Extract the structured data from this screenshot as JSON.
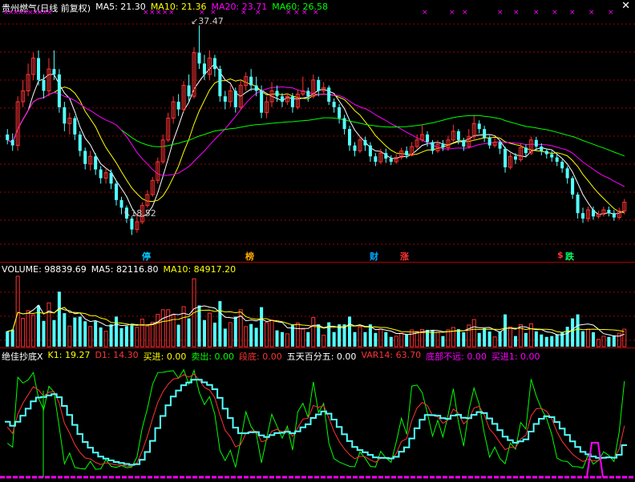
{
  "colors": {
    "ma5": "#ffffff",
    "ma10": "#ffff00",
    "ma20": "#ff00ff",
    "ma60": "#00ff00",
    "up": "#ff3333",
    "down": "#54ffff",
    "grid": "#a00000",
    "k_line": "#ffff00",
    "d_line": "#ff3333"
  },
  "price_header": {
    "title": "贵州燃气(日线 前复权)",
    "ma5": "MA5: 21.30",
    "ma10": "MA10: 21.36",
    "ma20": "MA20: 23.71",
    "ma60": "MA60: 26.58"
  },
  "price_annotations": {
    "high": "37.47",
    "low": "18.52"
  },
  "event_markers": [
    "停",
    "榜",
    "财",
    "涨",
    "$",
    "跌"
  ],
  "volume_header": {
    "volume": "VOLUME: 98839.69",
    "ma5": "MA5: 82116.80",
    "ma10": "MA10: 84917.20"
  },
  "indicator_header": {
    "name": "绝佳抄底X",
    "k1": "K1: 19.27",
    "d1": "D1: 14.30",
    "buy_in": "买进: 0.00",
    "sell_out": "卖出: 0.00",
    "bottom_zone": "段底: 0.00",
    "five_day": "五天百分五: 0.00",
    "var14": "VAR14: 63.70",
    "bottom_near": "底部不远: 0.00",
    "buy_in1": "买进1: 0.00"
  },
  "chart_data": {
    "type": "candlestick",
    "price_range": [
      16.5,
      38.5
    ],
    "candles": [
      [
        27.5,
        27.0,
        28.0,
        26.6
      ],
      [
        27.0,
        26.5,
        27.6,
        26.0
      ],
      [
        26.5,
        30.5,
        31.0,
        26.0
      ],
      [
        30.5,
        31.5,
        32.5,
        30.0
      ],
      [
        31.5,
        33.0,
        34.0,
        31.0
      ],
      [
        33.0,
        34.5,
        35.0,
        32.5
      ],
      [
        34.5,
        32.5,
        35.2,
        32.0
      ],
      [
        32.5,
        31.5,
        33.0,
        30.8
      ],
      [
        31.5,
        33.5,
        34.5,
        31.0
      ],
      [
        33.5,
        33.0,
        35.2,
        32.5
      ],
      [
        33.0,
        30.0,
        33.5,
        29.5
      ],
      [
        30.0,
        28.5,
        30.5,
        27.8
      ],
      [
        28.5,
        29.0,
        29.5,
        27.5
      ],
      [
        29.0,
        27.5,
        29.2,
        27.0
      ],
      [
        27.5,
        26.0,
        27.8,
        25.5
      ],
      [
        26.0,
        24.8,
        26.3,
        24.3
      ],
      [
        24.8,
        25.5,
        26.0,
        24.2
      ],
      [
        25.5,
        24.3,
        25.8,
        23.8
      ],
      [
        24.3,
        23.5,
        24.6,
        23.0
      ],
      [
        23.5,
        24.0,
        24.4,
        23.0
      ],
      [
        24.0,
        23.0,
        24.3,
        22.5
      ],
      [
        23.0,
        21.5,
        23.3,
        21.0
      ],
      [
        21.5,
        20.8,
        21.8,
        20.2
      ],
      [
        20.8,
        19.8,
        21.0,
        19.4
      ],
      [
        19.8,
        18.8,
        20.0,
        18.3
      ],
      [
        18.8,
        19.5,
        20.2,
        18.5
      ],
      [
        19.5,
        21.0,
        21.3,
        19.3
      ],
      [
        21.0,
        22.0,
        22.4,
        20.8
      ],
      [
        22.0,
        23.3,
        23.6,
        21.8
      ],
      [
        23.3,
        25.0,
        25.4,
        23.0
      ],
      [
        25.0,
        27.0,
        27.5,
        24.8
      ],
      [
        27.0,
        29.0,
        29.5,
        26.8
      ],
      [
        29.0,
        30.5,
        31.0,
        28.5
      ],
      [
        30.5,
        29.8,
        31.2,
        29.2
      ],
      [
        29.8,
        32.0,
        32.4,
        29.5
      ],
      [
        32.0,
        31.0,
        33.0,
        30.5
      ],
      [
        31.0,
        35.0,
        35.5,
        30.8
      ],
      [
        35.0,
        34.0,
        37.5,
        33.5
      ],
      [
        34.0,
        33.0,
        34.8,
        32.5
      ],
      [
        33.0,
        34.5,
        35.2,
        32.5
      ],
      [
        34.5,
        33.5,
        34.8,
        32.8
      ],
      [
        33.5,
        31.0,
        33.8,
        30.5
      ],
      [
        31.0,
        30.5,
        31.5,
        29.8
      ],
      [
        30.5,
        31.5,
        32.0,
        30.0
      ],
      [
        31.5,
        30.0,
        31.8,
        29.5
      ],
      [
        30.0,
        32.0,
        32.5,
        29.8
      ],
      [
        32.0,
        32.8,
        33.2,
        31.5
      ],
      [
        32.8,
        32.0,
        33.5,
        31.5
      ],
      [
        32.0,
        31.5,
        32.8,
        31.0
      ],
      [
        31.5,
        29.5,
        32.0,
        29.0
      ],
      [
        29.5,
        30.5,
        31.0,
        29.0
      ],
      [
        30.5,
        31.5,
        32.3,
        30.0
      ],
      [
        31.5,
        31.0,
        32.0,
        30.5
      ],
      [
        31.0,
        30.5,
        31.3,
        30.0
      ],
      [
        30.5,
        31.0,
        31.3,
        30.2
      ],
      [
        31.0,
        30.0,
        31.3,
        29.5
      ],
      [
        30.0,
        31.2,
        31.6,
        29.8
      ],
      [
        31.2,
        31.5,
        32.8,
        31.0
      ],
      [
        31.5,
        31.0,
        31.8,
        30.5
      ],
      [
        31.0,
        32.5,
        33.0,
        30.8
      ],
      [
        32.5,
        31.5,
        32.8,
        31.0
      ],
      [
        31.5,
        31.8,
        32.3,
        31.2
      ],
      [
        31.8,
        30.5,
        32.0,
        30.2
      ],
      [
        30.5,
        30.0,
        30.8,
        29.5
      ],
      [
        30.0,
        29.0,
        30.3,
        28.5
      ],
      [
        29.0,
        28.0,
        29.3,
        27.5
      ],
      [
        28.0,
        26.5,
        28.3,
        26.0
      ],
      [
        26.5,
        26.0,
        26.8,
        25.5
      ],
      [
        26.0,
        27.0,
        27.3,
        25.8
      ],
      [
        27.0,
        26.5,
        27.3,
        26.0
      ],
      [
        26.5,
        25.5,
        26.8,
        25.0
      ],
      [
        25.5,
        25.0,
        25.8,
        24.6
      ],
      [
        25.0,
        25.8,
        26.2,
        24.8
      ],
      [
        25.8,
        25.3,
        26.2,
        24.9
      ],
      [
        25.3,
        25.0,
        25.6,
        24.7
      ],
      [
        25.0,
        25.4,
        25.7,
        24.8
      ],
      [
        25.4,
        26.0,
        26.3,
        25.2
      ],
      [
        26.0,
        25.6,
        26.4,
        25.3
      ],
      [
        25.6,
        26.4,
        26.8,
        25.5
      ],
      [
        26.4,
        27.0,
        27.5,
        26.2
      ],
      [
        27.0,
        27.5,
        28.4,
        26.8
      ],
      [
        27.5,
        26.8,
        27.8,
        26.4
      ],
      [
        26.8,
        26.0,
        27.0,
        25.7
      ],
      [
        26.0,
        26.6,
        27.0,
        25.8
      ],
      [
        26.6,
        26.3,
        27.0,
        26.0
      ],
      [
        26.3,
        27.0,
        27.4,
        26.0
      ],
      [
        27.0,
        27.8,
        28.4,
        26.8
      ],
      [
        27.8,
        27.0,
        28.0,
        26.6
      ],
      [
        27.0,
        26.4,
        27.2,
        26.0
      ],
      [
        26.4,
        27.3,
        28.0,
        26.2
      ],
      [
        27.3,
        28.5,
        29.2,
        27.0
      ],
      [
        28.5,
        28.0,
        28.8,
        27.6
      ],
      [
        28.0,
        27.2,
        28.3,
        26.8
      ],
      [
        27.2,
        26.5,
        27.4,
        26.2
      ],
      [
        26.5,
        26.8,
        27.2,
        26.3
      ],
      [
        26.8,
        26.2,
        27.0,
        25.7
      ],
      [
        26.2,
        24.5,
        26.4,
        24.0
      ],
      [
        24.5,
        25.5,
        25.8,
        24.3
      ],
      [
        25.5,
        25.2,
        25.8,
        24.8
      ],
      [
        25.2,
        26.3,
        26.7,
        25.0
      ],
      [
        26.3,
        25.8,
        26.6,
        25.4
      ],
      [
        25.8,
        27.0,
        27.3,
        25.6
      ],
      [
        27.0,
        26.4,
        27.3,
        26.0
      ],
      [
        26.4,
        26.0,
        26.7,
        25.6
      ],
      [
        26.0,
        25.7,
        26.2,
        25.3
      ],
      [
        25.7,
        25.4,
        26.0,
        25.0
      ],
      [
        25.4,
        25.0,
        25.7,
        24.6
      ],
      [
        25.0,
        24.4,
        25.2,
        24.0
      ],
      [
        24.4,
        23.5,
        24.6,
        23.0
      ],
      [
        23.5,
        22.0,
        23.7,
        21.6
      ],
      [
        22.0,
        20.3,
        22.2,
        19.8
      ],
      [
        20.3,
        19.8,
        20.8,
        19.4
      ],
      [
        19.8,
        20.6,
        20.9,
        19.5
      ],
      [
        20.6,
        20.0,
        20.9,
        19.7
      ],
      [
        20.0,
        20.2,
        20.5,
        19.8
      ],
      [
        20.2,
        20.6,
        20.9,
        20.0
      ],
      [
        20.6,
        20.3,
        20.9,
        20.0
      ],
      [
        20.3,
        19.9,
        20.6,
        19.6
      ],
      [
        19.9,
        20.5,
        20.8,
        19.7
      ],
      [
        20.5,
        21.3,
        21.6,
        20.2
      ]
    ]
  }
}
